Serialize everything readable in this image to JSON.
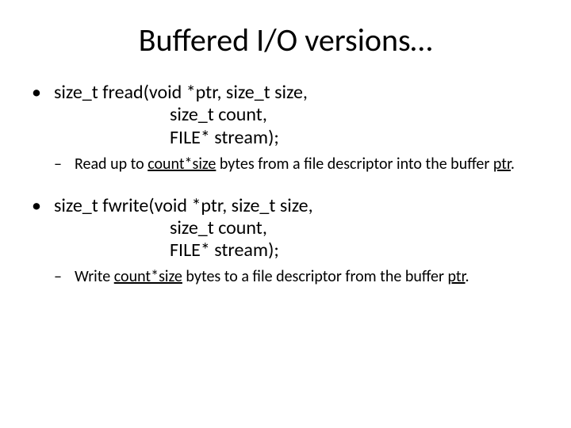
{
  "title": "Buffered I/O versions…",
  "item1": {
    "sig_l1": "size_t fread(void *ptr, size_t size,",
    "sig_l2": "size_t count,",
    "sig_l3": "FILE* stream);",
    "desc_pre": "Read up to ",
    "desc_u1": "count*size",
    "desc_mid": " bytes from a file descriptor into the buffer ",
    "desc_u2": "ptr",
    "desc_post": "."
  },
  "item2": {
    "sig_l1": "size_t fwrite(void *ptr, size_t size,",
    "sig_l2": "size_t count,",
    "sig_l3": "FILE* stream);",
    "desc_pre": "Write ",
    "desc_u1": "count*size",
    "desc_mid": " bytes to a file descriptor from the buffer ",
    "desc_u2": "ptr",
    "desc_post": "."
  }
}
